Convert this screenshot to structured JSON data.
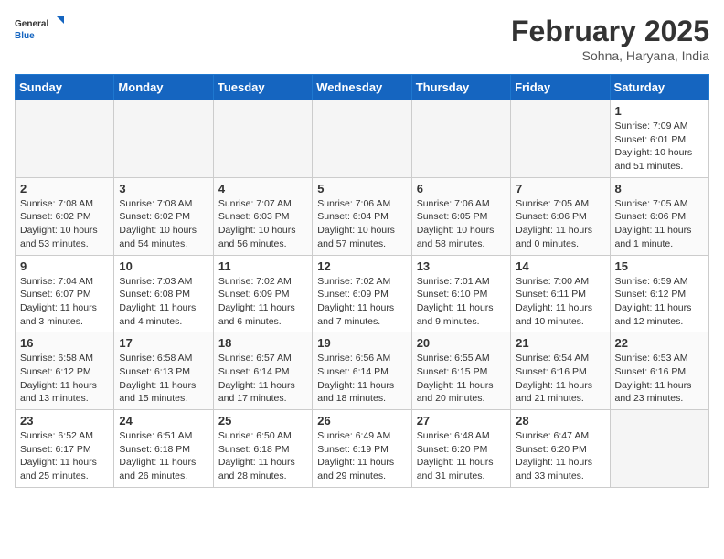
{
  "header": {
    "logo_general": "General",
    "logo_blue": "Blue",
    "month_title": "February 2025",
    "location": "Sohna, Haryana, India"
  },
  "days_of_week": [
    "Sunday",
    "Monday",
    "Tuesday",
    "Wednesday",
    "Thursday",
    "Friday",
    "Saturday"
  ],
  "weeks": [
    [
      {
        "num": "",
        "info": ""
      },
      {
        "num": "",
        "info": ""
      },
      {
        "num": "",
        "info": ""
      },
      {
        "num": "",
        "info": ""
      },
      {
        "num": "",
        "info": ""
      },
      {
        "num": "",
        "info": ""
      },
      {
        "num": "1",
        "info": "Sunrise: 7:09 AM\nSunset: 6:01 PM\nDaylight: 10 hours\nand 51 minutes."
      }
    ],
    [
      {
        "num": "2",
        "info": "Sunrise: 7:08 AM\nSunset: 6:02 PM\nDaylight: 10 hours\nand 53 minutes."
      },
      {
        "num": "3",
        "info": "Sunrise: 7:08 AM\nSunset: 6:02 PM\nDaylight: 10 hours\nand 54 minutes."
      },
      {
        "num": "4",
        "info": "Sunrise: 7:07 AM\nSunset: 6:03 PM\nDaylight: 10 hours\nand 56 minutes."
      },
      {
        "num": "5",
        "info": "Sunrise: 7:06 AM\nSunset: 6:04 PM\nDaylight: 10 hours\nand 57 minutes."
      },
      {
        "num": "6",
        "info": "Sunrise: 7:06 AM\nSunset: 6:05 PM\nDaylight: 10 hours\nand 58 minutes."
      },
      {
        "num": "7",
        "info": "Sunrise: 7:05 AM\nSunset: 6:06 PM\nDaylight: 11 hours\nand 0 minutes."
      },
      {
        "num": "8",
        "info": "Sunrise: 7:05 AM\nSunset: 6:06 PM\nDaylight: 11 hours\nand 1 minute."
      }
    ],
    [
      {
        "num": "9",
        "info": "Sunrise: 7:04 AM\nSunset: 6:07 PM\nDaylight: 11 hours\nand 3 minutes."
      },
      {
        "num": "10",
        "info": "Sunrise: 7:03 AM\nSunset: 6:08 PM\nDaylight: 11 hours\nand 4 minutes."
      },
      {
        "num": "11",
        "info": "Sunrise: 7:02 AM\nSunset: 6:09 PM\nDaylight: 11 hours\nand 6 minutes."
      },
      {
        "num": "12",
        "info": "Sunrise: 7:02 AM\nSunset: 6:09 PM\nDaylight: 11 hours\nand 7 minutes."
      },
      {
        "num": "13",
        "info": "Sunrise: 7:01 AM\nSunset: 6:10 PM\nDaylight: 11 hours\nand 9 minutes."
      },
      {
        "num": "14",
        "info": "Sunrise: 7:00 AM\nSunset: 6:11 PM\nDaylight: 11 hours\nand 10 minutes."
      },
      {
        "num": "15",
        "info": "Sunrise: 6:59 AM\nSunset: 6:12 PM\nDaylight: 11 hours\nand 12 minutes."
      }
    ],
    [
      {
        "num": "16",
        "info": "Sunrise: 6:58 AM\nSunset: 6:12 PM\nDaylight: 11 hours\nand 13 minutes."
      },
      {
        "num": "17",
        "info": "Sunrise: 6:58 AM\nSunset: 6:13 PM\nDaylight: 11 hours\nand 15 minutes."
      },
      {
        "num": "18",
        "info": "Sunrise: 6:57 AM\nSunset: 6:14 PM\nDaylight: 11 hours\nand 17 minutes."
      },
      {
        "num": "19",
        "info": "Sunrise: 6:56 AM\nSunset: 6:14 PM\nDaylight: 11 hours\nand 18 minutes."
      },
      {
        "num": "20",
        "info": "Sunrise: 6:55 AM\nSunset: 6:15 PM\nDaylight: 11 hours\nand 20 minutes."
      },
      {
        "num": "21",
        "info": "Sunrise: 6:54 AM\nSunset: 6:16 PM\nDaylight: 11 hours\nand 21 minutes."
      },
      {
        "num": "22",
        "info": "Sunrise: 6:53 AM\nSunset: 6:16 PM\nDaylight: 11 hours\nand 23 minutes."
      }
    ],
    [
      {
        "num": "23",
        "info": "Sunrise: 6:52 AM\nSunset: 6:17 PM\nDaylight: 11 hours\nand 25 minutes."
      },
      {
        "num": "24",
        "info": "Sunrise: 6:51 AM\nSunset: 6:18 PM\nDaylight: 11 hours\nand 26 minutes."
      },
      {
        "num": "25",
        "info": "Sunrise: 6:50 AM\nSunset: 6:18 PM\nDaylight: 11 hours\nand 28 minutes."
      },
      {
        "num": "26",
        "info": "Sunrise: 6:49 AM\nSunset: 6:19 PM\nDaylight: 11 hours\nand 29 minutes."
      },
      {
        "num": "27",
        "info": "Sunrise: 6:48 AM\nSunset: 6:20 PM\nDaylight: 11 hours\nand 31 minutes."
      },
      {
        "num": "28",
        "info": "Sunrise: 6:47 AM\nSunset: 6:20 PM\nDaylight: 11 hours\nand 33 minutes."
      },
      {
        "num": "",
        "info": ""
      }
    ]
  ]
}
